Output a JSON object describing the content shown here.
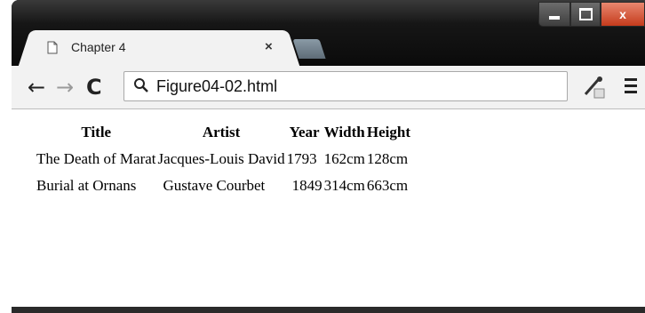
{
  "tab": {
    "title": "Chapter 4",
    "close": "×"
  },
  "window_controls": {
    "close": "x"
  },
  "toolbar": {
    "back": "←",
    "forward": "→",
    "reload": "C",
    "url": "Figure04-02.html"
  },
  "table": {
    "headers": [
      "Title",
      "Artist",
      "Year",
      "Width",
      "Height"
    ],
    "rows": [
      [
        "The Death of Marat",
        "Jacques-Louis David",
        "1793",
        "162cm",
        "128cm"
      ],
      [
        "Burial at Ornans",
        "Gustave Courbet",
        "1849",
        "314cm",
        "663cm"
      ]
    ]
  }
}
